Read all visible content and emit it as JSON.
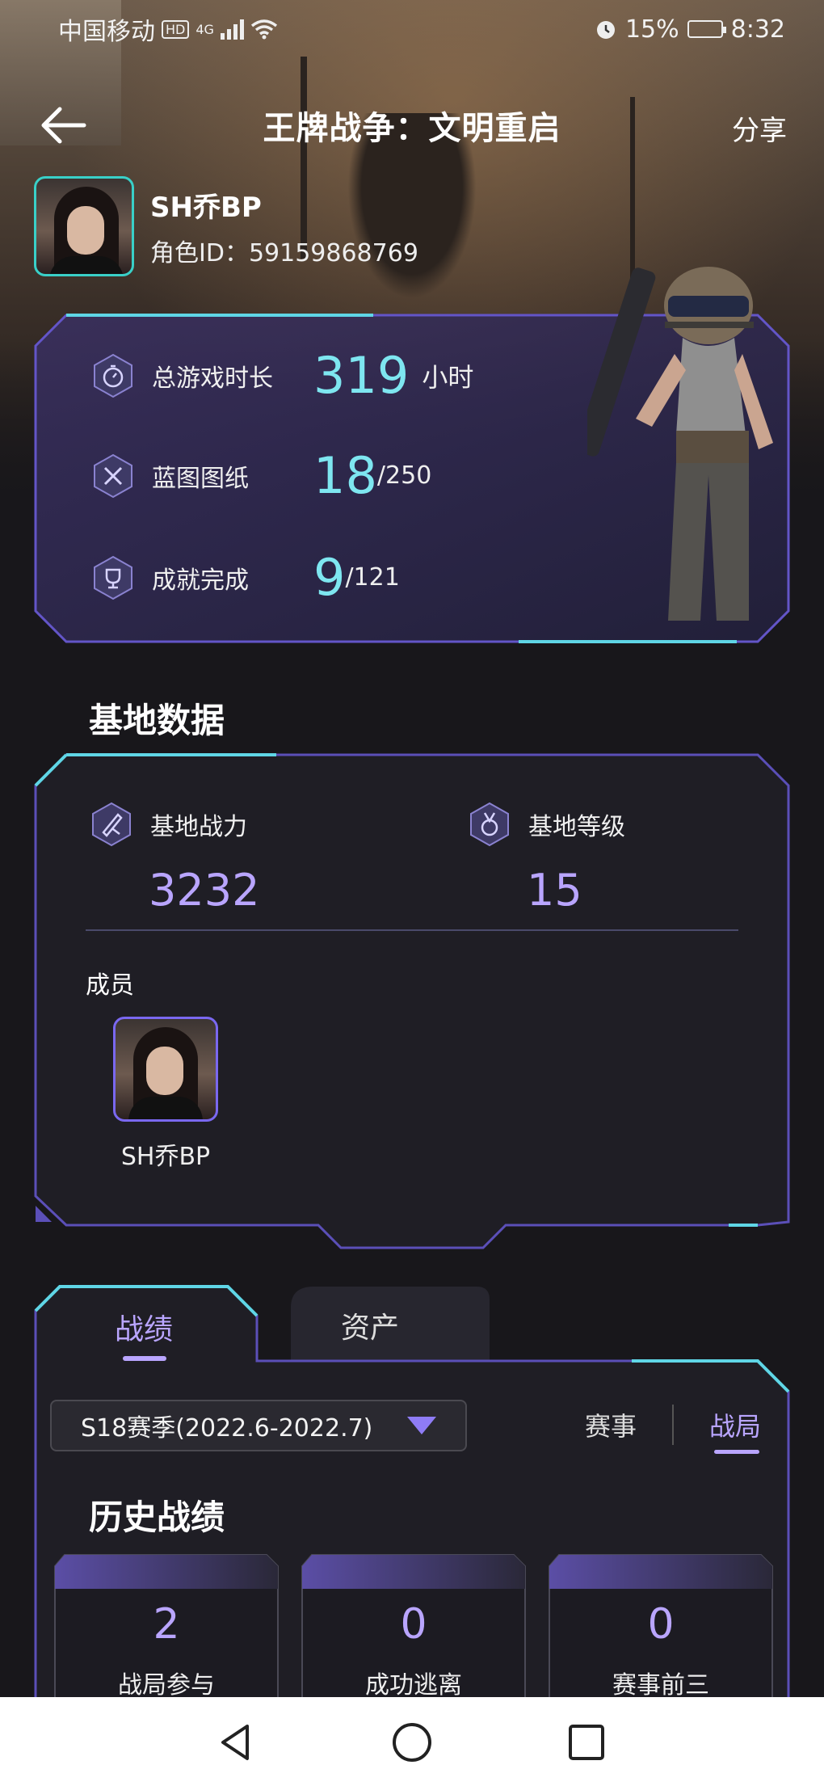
{
  "status_bar": {
    "carrier": "中国移动",
    "hd": "HD",
    "network": "4G",
    "battery": "15%",
    "time": "8:32"
  },
  "header": {
    "title": "王牌战争：文明重启",
    "share": "分享"
  },
  "profile": {
    "name": "SH乔BP",
    "role_id": "角色ID：59159868769"
  },
  "stats": {
    "playtime_label": "总游戏时长",
    "playtime_value": "319",
    "playtime_unit": "小时",
    "blueprint_label": "蓝图图纸",
    "blueprint_value": "18",
    "blueprint_total": "/250",
    "achievement_label": "成就完成",
    "achievement_value": "9",
    "achievement_total": "/121"
  },
  "base": {
    "section_title": "基地数据",
    "power_label": "基地战力",
    "power_value": "3232",
    "level_label": "基地等级",
    "level_value": "15",
    "members_label": "成员",
    "members": [
      {
        "name": "SH乔BP"
      }
    ]
  },
  "tabs": {
    "record": "战绩",
    "assets": "资产"
  },
  "filter": {
    "season": "S18赛季(2022.6-2022.7)",
    "seg_events": "赛事",
    "seg_matches": "战局"
  },
  "history": {
    "title": "历史战绩",
    "cards": [
      {
        "value": "2",
        "label": "战局参与"
      },
      {
        "value": "0",
        "label": "成功逃离"
      },
      {
        "value": "0",
        "label": "赛事前三"
      }
    ]
  },
  "colors": {
    "accent_purple": "#b9a5ff",
    "accent_cyan": "#7ee6f0",
    "background": "#18171b"
  }
}
